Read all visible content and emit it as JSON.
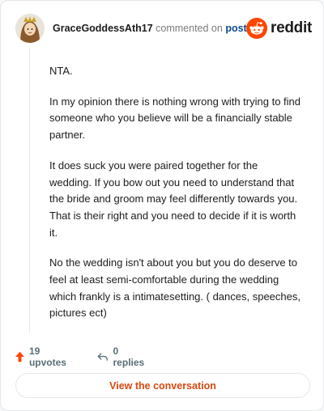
{
  "header": {
    "username": "GraceGoddessAth17",
    "commented_text": "commented on",
    "post_link": "post",
    "brand": "reddit"
  },
  "comment": {
    "paragraphs": [
      "NTA.",
      "In my opinion there is nothing wrong with trying to find someone who you believe will be a financially stable partner.",
      "It does suck you were paired together for the wedding. If you bow out you need to understand that the bride and groom may feel differently towards you. That is their right and you need to decide if it is worth it.",
      "No the wedding isn't about you but you do deserve to feel at least semi-comfortable during the wedding which frankly is a intimatesetting. ( dances, speeches, pictures ect)"
    ]
  },
  "actions": {
    "upvotes": "19 upvotes",
    "replies": "0 replies"
  },
  "cta": {
    "label": "View the conversation"
  },
  "colors": {
    "accent": "#d9480f",
    "upvote": "#ff4500",
    "link": "#0f4a8a"
  },
  "icons": {
    "avatar": "avatar",
    "brand": "reddit-snoo-icon",
    "upvote": "upvote-arrow-icon",
    "reply": "reply-arrow-icon"
  }
}
